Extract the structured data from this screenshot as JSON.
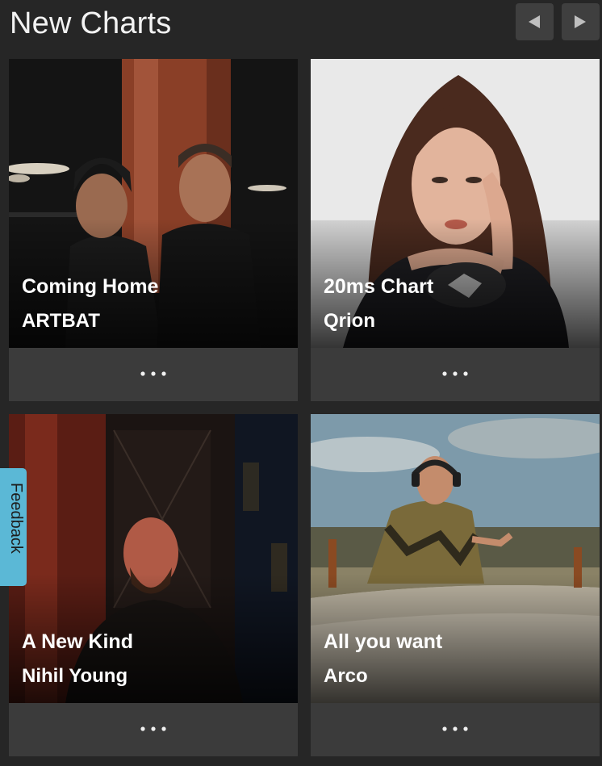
{
  "header": {
    "title": "New Charts",
    "prev_icon": "triangle-left-icon",
    "next_icon": "triangle-right-icon"
  },
  "cards": [
    {
      "title": "Coming Home",
      "artist": "ARTBAT",
      "menu_icon": "ellipsis-icon"
    },
    {
      "title": "20ms Chart",
      "artist": "Qrion",
      "menu_icon": "ellipsis-icon"
    },
    {
      "title": "A New Kind",
      "artist": "Nihil Young",
      "menu_icon": "ellipsis-icon"
    },
    {
      "title": "All you want",
      "artist": "Arco",
      "menu_icon": "ellipsis-icon"
    }
  ],
  "feedback": {
    "label": "Feedback"
  },
  "colors": {
    "background": "#262626",
    "nav_button": "#3f3f3f",
    "card_footer": "#3b3b3b",
    "feedback_tab": "#5bb8d6"
  }
}
